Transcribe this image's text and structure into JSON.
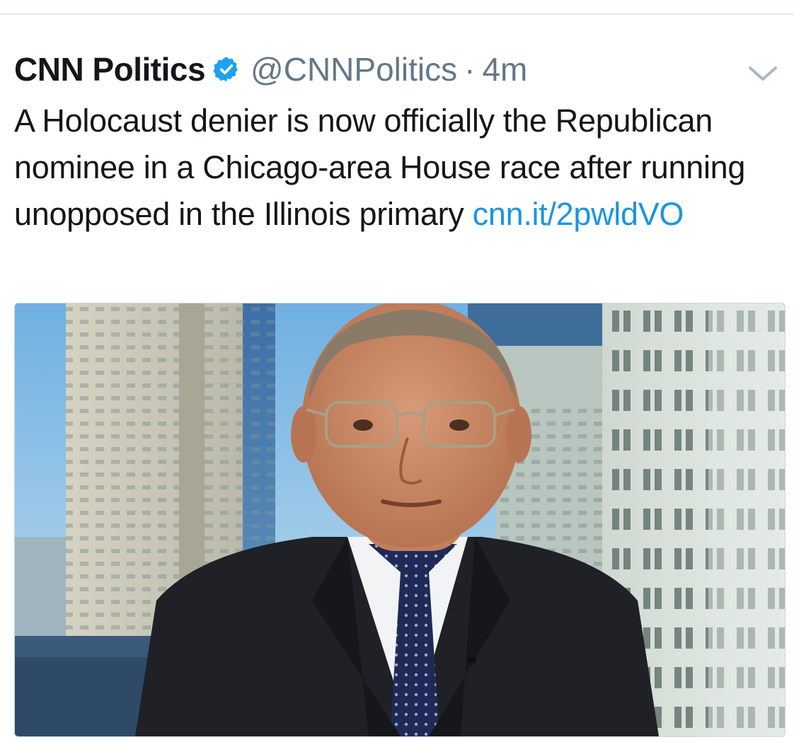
{
  "tweet": {
    "display_name": "CNN Politics",
    "verified": true,
    "handle": "@CNNPolitics",
    "separator": "·",
    "time": "4m",
    "text": "A Holocaust denier is now officially the Republican nominee in a Chicago-area House race after running unopposed in the Illinois primary",
    "link": "cnn.it/2pwldVO"
  },
  "icons": {
    "verified": "verified-badge-icon",
    "menu": "chevron-down-icon"
  },
  "colors": {
    "link": "#1b95e0",
    "secondary_text": "#657786",
    "verified_badge": "#1da1f2",
    "divider": "#e1e8ed"
  }
}
